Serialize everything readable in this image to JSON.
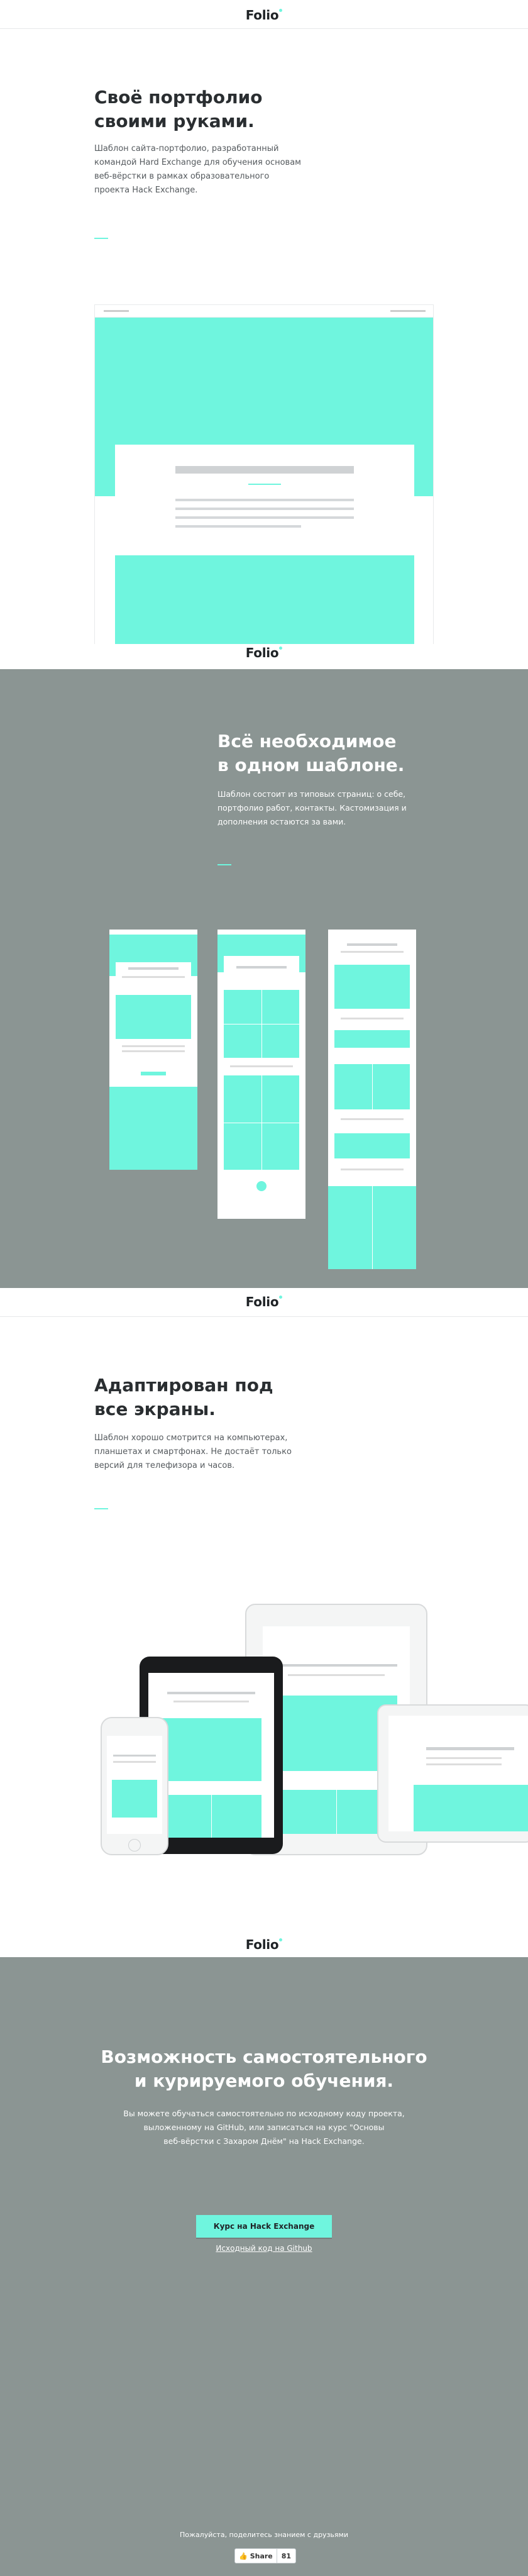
{
  "logo": {
    "text": "Folio"
  },
  "section1": {
    "title_line1": "Своё портфолио",
    "title_line2": "своими руками.",
    "description": [
      "Шаблон сайта-портфолио, разработанный",
      "командой Hard Exchange для обучения основам",
      "веб-вёрстки в рамках образовательного",
      "проекта Hack Exchange."
    ]
  },
  "section2": {
    "title_line1": "Всё необходимое",
    "title_line2": "в одном шаблоне.",
    "description": [
      "Шаблон состоит из типовых страниц: о себе,",
      "портфолио работ, контакты. Кастомизация и",
      "дополнения остаются за вами."
    ]
  },
  "section3": {
    "title_line1": "Адаптирован под",
    "title_line2": "все экраны.",
    "description": [
      "Шаблон хорошо смотрится на компьютерах,",
      "планшетах и смартфонах. Не достаёт только",
      "версий для телефизора и часов."
    ]
  },
  "section4": {
    "title_line1": "Возможность самостоятельного",
    "title_line2": "и курируемого обучения.",
    "description": [
      "Вы можете обучаться самостоятельно по исходному коду проекта,",
      "выложенному на GitHub, или записаться на курс \"Основы",
      "веб-вёрстки с Захаром Днём\" на Hack Exchange."
    ],
    "cta_label": "Курс на Hack Exchange",
    "source_link": "Исходный код на Github",
    "share_prompt": "Пожалуйста, поделитесь знанием с друзьями",
    "share_label": "Share",
    "share_count": "81"
  },
  "colors": {
    "accent": "#6ff5de",
    "gray_section": "#8b9593",
    "text_dark": "#2a2e31"
  }
}
